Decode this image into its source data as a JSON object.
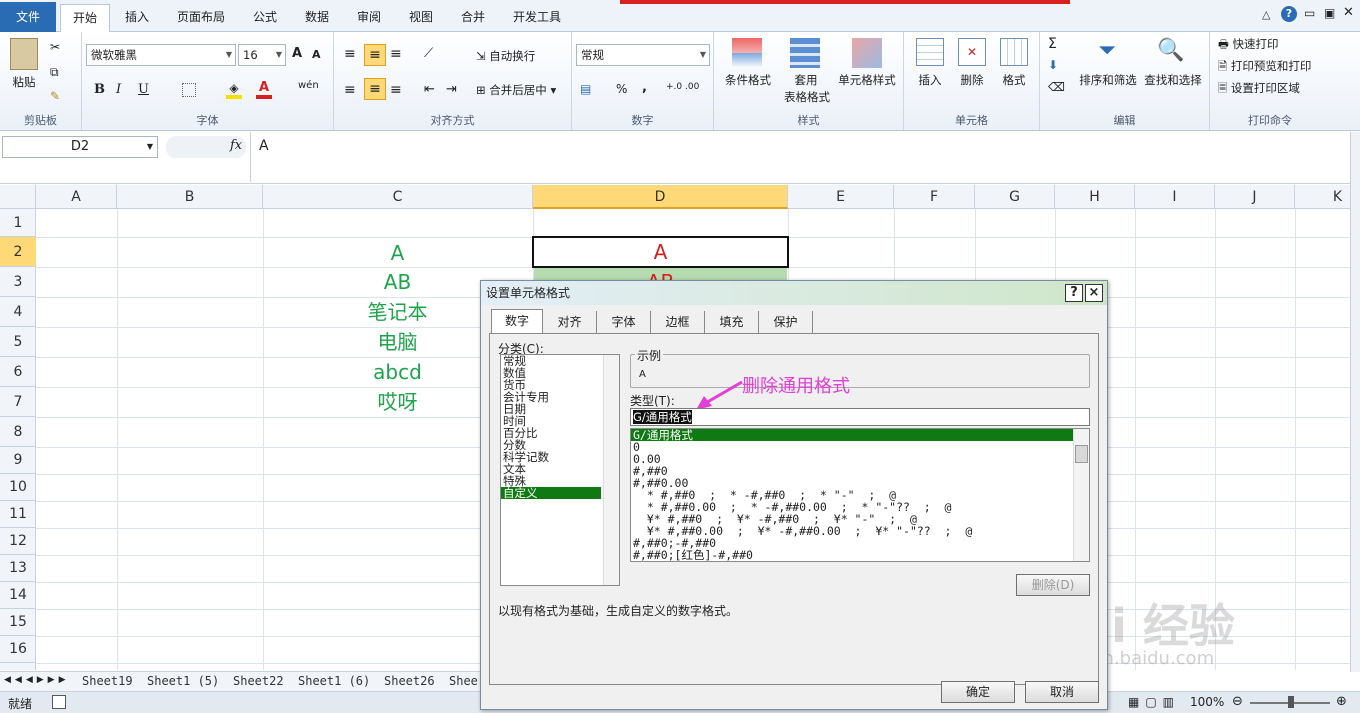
{
  "ribbon_tabs": [
    "文件",
    "开始",
    "插入",
    "页面布局",
    "公式",
    "数据",
    "审阅",
    "视图",
    "合并",
    "开发工具"
  ],
  "clipboard": {
    "paste": "粘贴",
    "label": "剪贴板"
  },
  "font": {
    "name": "微软雅黑",
    "size": "16",
    "label": "字体",
    "bold": "B",
    "italic": "I",
    "underline": "U",
    "grow": "A",
    "shrink": "A",
    "color_a": "A",
    "wen": "wén"
  },
  "align": {
    "wrap": "自动换行",
    "merge": "合并后居中",
    "label": "对齐方式"
  },
  "number": {
    "format": "常规",
    "pct": "%",
    "comma": ",",
    "inc": "+.0 .00",
    "dec": ".00 →.0",
    "label": "数字"
  },
  "styles": {
    "cond": "条件格式",
    "table": "套用",
    "table2": "表格格式",
    "cell": "单元格样式",
    "label": "样式"
  },
  "cells": {
    "insert": "插入",
    "delete": "删除",
    "format": "格式",
    "label": "单元格"
  },
  "edit": {
    "sigma": "Σ",
    "sort": "排序和筛选",
    "find": "查找和选择",
    "label": "编辑"
  },
  "print": {
    "quick": "快速打印",
    "preview": "打印预览和打印",
    "area": "设置打印区域",
    "label": "打印命令"
  },
  "formula_bar": {
    "name_box": "D2",
    "fx": "fx",
    "value": "A"
  },
  "columns": [
    "A",
    "B",
    "C",
    "D",
    "E",
    "F",
    "G",
    "H",
    "I",
    "J",
    "K"
  ],
  "rows": [
    "1",
    "2",
    "3",
    "4",
    "5",
    "6",
    "7",
    "8",
    "9",
    "10",
    "11",
    "12",
    "13",
    "14",
    "15",
    "16"
  ],
  "cells_data": {
    "C2": "A",
    "C3": "AB",
    "C4": "笔记本",
    "C5": "电脑",
    "C6": "abcd",
    "C7": "哎呀",
    "D2": "A",
    "D3": "AB"
  },
  "sheet_tabs": [
    "Sheet19",
    "Sheet1 (5)",
    "Sheet22",
    "Sheet1 (6)",
    "Sheet26",
    "Shee"
  ],
  "status": {
    "ready": "就绪",
    "zoom": "100%"
  },
  "dialog": {
    "title": "设置单元格格式",
    "help": "?",
    "close": "×",
    "tabs": [
      "数字",
      "对齐",
      "字体",
      "边框",
      "填充",
      "保护"
    ],
    "category_label": "分类(C):",
    "categories": [
      "常规",
      "数值",
      "货币",
      "会计专用",
      "日期",
      "时间",
      "百分比",
      "分数",
      "科学记数",
      "文本",
      "特殊",
      "自定义"
    ],
    "sample_label": "示例",
    "sample_value": "A",
    "type_label": "类型(T):",
    "type_value": "G/通用格式",
    "annotation": "删除通用格式",
    "type_list": [
      "G/通用格式",
      "0",
      "0.00",
      "#,##0",
      "#,##0.00",
      "_ * #,##0_ ;_ * -#,##0_ ;_ * \"-\"_ ;_ @_",
      "_ * #,##0.00_ ;_ * -#,##0.00_ ;_ * \"-\"??_ ;_ @_",
      "_ ¥* #,##0_ ;_ ¥* -#,##0_ ;_ ¥* \"-\"_ ;_ @_",
      "_ ¥* #,##0.00_ ;_ ¥* -#,##0.00_ ;_ ¥* \"-\"??_ ;_ @_",
      "#,##0;-#,##0",
      "#,##0;[红色]-#,##0"
    ],
    "delete_btn": "删除(D)",
    "hint": "以现有格式为基础，生成自定义的数字格式。",
    "ok": "确定",
    "cancel": "取消"
  },
  "watermark": {
    "brand": "Bai  经验",
    "url": "jingyan.baidu.com"
  },
  "colors": {
    "accent_green": "#1ea54b",
    "red": "#d42020",
    "selected": "#0f7a12",
    "annotation": "#e23fd6"
  }
}
